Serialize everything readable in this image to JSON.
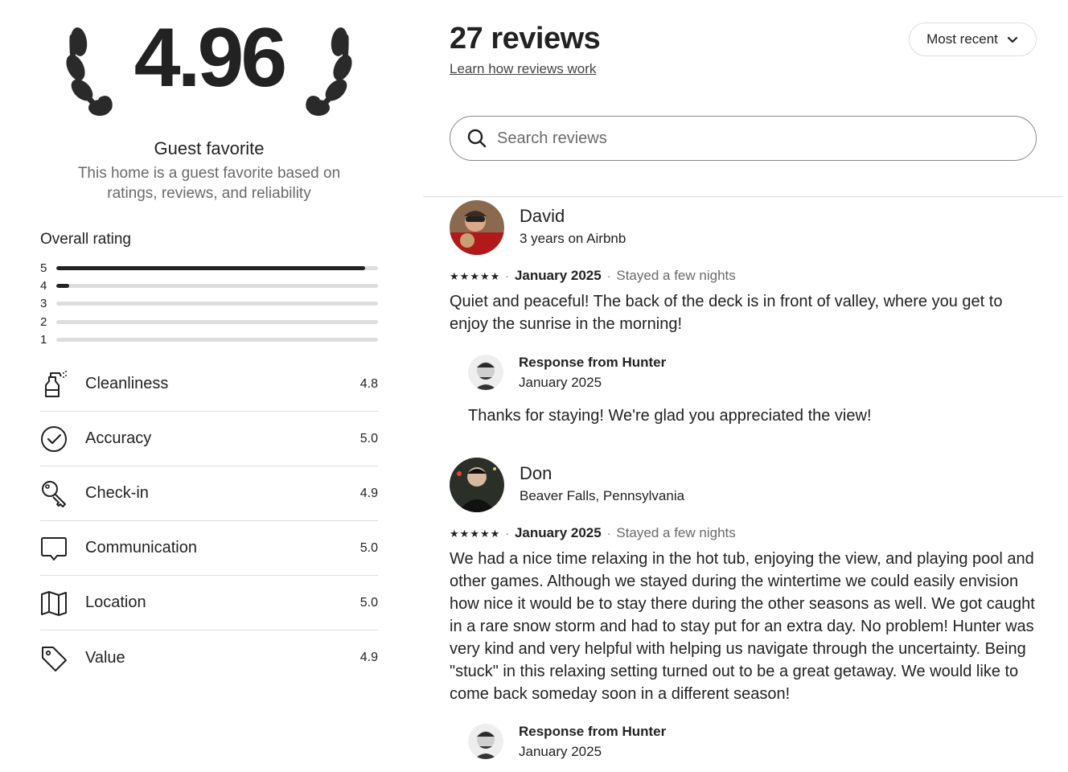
{
  "summary": {
    "overall_rating": "4.96",
    "badge_title": "Guest favorite",
    "badge_subtitle": "This home is a guest favorite based on ratings, reviews, and reliability",
    "overall_label": "Overall rating",
    "distribution": [
      {
        "stars": "5",
        "fraction": 0.96
      },
      {
        "stars": "4",
        "fraction": 0.04
      },
      {
        "stars": "3",
        "fraction": 0
      },
      {
        "stars": "2",
        "fraction": 0
      },
      {
        "stars": "1",
        "fraction": 0
      }
    ],
    "categories": [
      {
        "label": "Cleanliness",
        "score": "4.8",
        "icon": "spray-bottle-icon"
      },
      {
        "label": "Accuracy",
        "score": "5.0",
        "icon": "check-circle-icon"
      },
      {
        "label": "Check-in",
        "score": "4.9",
        "icon": "key-icon"
      },
      {
        "label": "Communication",
        "score": "5.0",
        "icon": "chat-bubble-icon"
      },
      {
        "label": "Location",
        "score": "5.0",
        "icon": "map-icon"
      },
      {
        "label": "Value",
        "score": "4.9",
        "icon": "price-tag-icon"
      }
    ]
  },
  "header": {
    "title": "27 reviews",
    "learn_link": "Learn how reviews work",
    "sort_label": "Most recent"
  },
  "search": {
    "placeholder": "Search reviews",
    "value": ""
  },
  "reviews": [
    {
      "name": "David",
      "subtitle": "3 years on Airbnb",
      "stars": 5,
      "date": "January 2025",
      "stay": "Stayed a few nights",
      "text": "Quiet and peaceful! The back of the deck is in front of valley, where you get to enjoy the sunrise in the morning!",
      "response": {
        "from": "Response from Hunter",
        "date": "January 2025",
        "text": "Thanks for staying! We're glad you appreciated the view!"
      }
    },
    {
      "name": "Don",
      "subtitle": "Beaver Falls, Pennsylvania",
      "stars": 5,
      "date": "January 2025",
      "stay": "Stayed a few nights",
      "text": "We had a nice time relaxing in the hot tub, enjoying the view, and playing pool and other games. Although we stayed during the wintertime we could easily envision how nice it would be to stay there during the other seasons as well. We got caught in a rare snow storm and had to stay put for an extra day. No problem! Hunter was very kind and very helpful with helping us navigate through the uncertainty. Being \"stuck\" in this relaxing setting turned out to be a great getaway. We would like to come back someday soon in a different season!",
      "response": {
        "from": "Response from Hunter",
        "date": "January 2025",
        "text": ""
      }
    }
  ]
}
